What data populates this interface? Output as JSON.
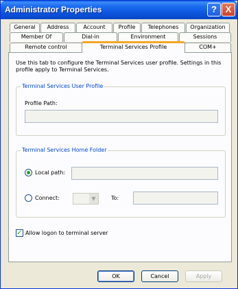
{
  "window": {
    "title": "Administrator Properties"
  },
  "titlebar_buttons": {
    "help": "?",
    "close": "X"
  },
  "tabs": {
    "row1": [
      "General",
      "Address",
      "Account",
      "Profile",
      "Telephones",
      "Organization"
    ],
    "row2": [
      "Member Of",
      "Dial-in",
      "Environment",
      "Sessions"
    ],
    "row3": [
      "Remote control",
      "Terminal Services Profile",
      "COM+"
    ],
    "selected": "Terminal Services Profile"
  },
  "description": "Use this tab to configure the Terminal Services user profile. Settings in this profile apply to Terminal Services.",
  "ts_user_profile": {
    "title": "Terminal Services User Profile",
    "profile_path_label": "Profile Path:",
    "profile_path_value": ""
  },
  "ts_home_folder": {
    "title": "Terminal Services Home Folder",
    "local_path_label": "Local path:",
    "local_path_value": "",
    "local_path_selected": true,
    "connect_label": "Connect:",
    "connect_drive_value": "",
    "to_label": "To:",
    "to_value": ""
  },
  "allow_logon": {
    "label": "Allow logon to terminal server",
    "checked": true
  },
  "buttons": {
    "ok": "OK",
    "cancel": "Cancel",
    "apply": "Apply"
  },
  "colors": {
    "title_bar": "#0b53db",
    "selected_tab_accent": "#f5a623",
    "group_title": "#0046d5",
    "check_mark": "#21a121"
  }
}
